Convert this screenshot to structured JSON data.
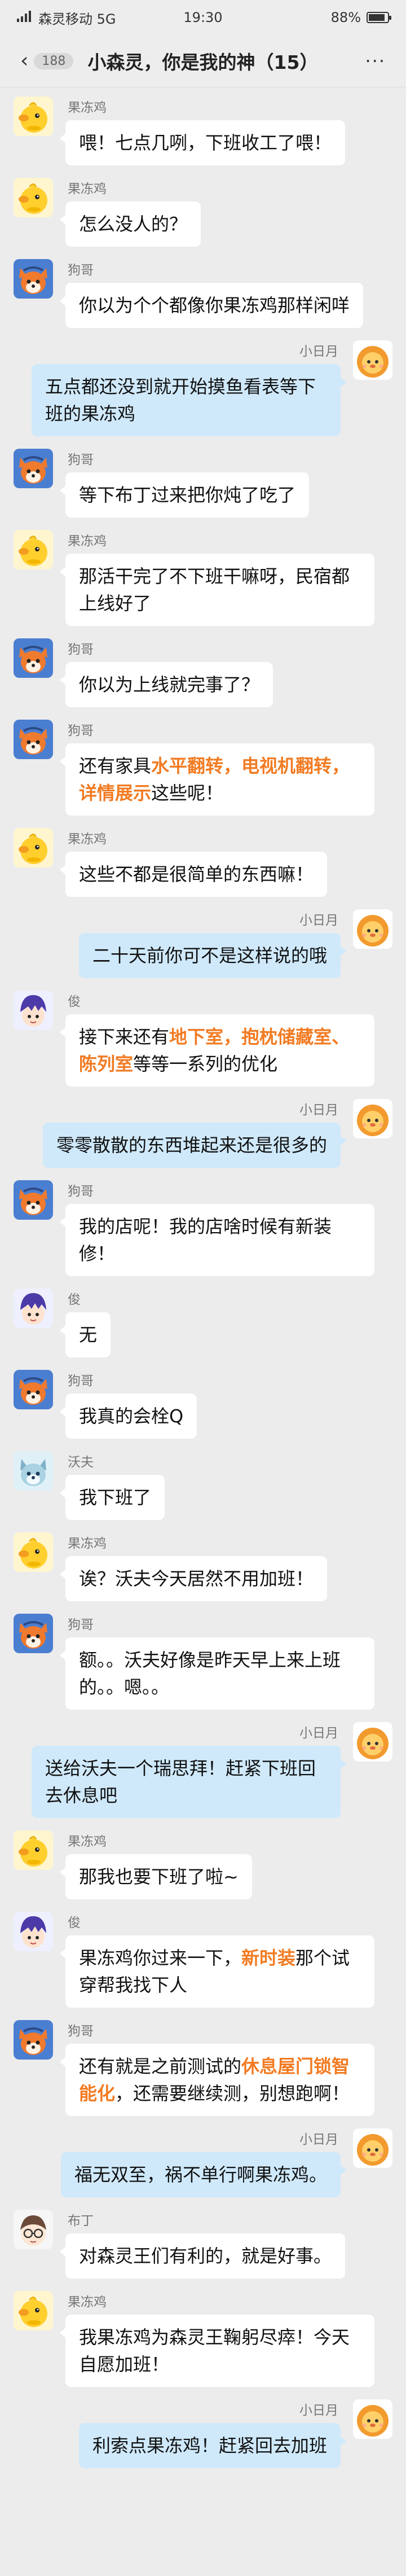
{
  "status_bar": {
    "carrier": "森灵移动 5G",
    "time": "19:30",
    "battery_text": "88%",
    "battery_level": 0.88
  },
  "header": {
    "back_count": "188",
    "title": "小森灵，你是我的神（15）",
    "menu_label": "···"
  },
  "colors": {
    "highlight": "#f27b22",
    "self_bubble": "#cfe9fb",
    "other_bubble": "#ffffff",
    "background": "#ececec"
  },
  "avatars": {
    "果冻鸡": "yellow-chick-avatar",
    "狗哥": "fox-avatar",
    "小日月": "lion-cub-avatar",
    "俊": "purple-hair-avatar",
    "沃夫": "wolf-avatar",
    "布丁": "glasses-avatar"
  },
  "messages": [
    {
      "side": "left",
      "sender": "果冻鸡",
      "segments": [
        {
          "text": "喂！七点几咧，下班收工了喂！"
        }
      ]
    },
    {
      "side": "left",
      "sender": "果冻鸡",
      "segments": [
        {
          "text": "怎么没人的？"
        }
      ]
    },
    {
      "side": "left",
      "sender": "狗哥",
      "segments": [
        {
          "text": "你以为个个都像你果冻鸡那样闲咩"
        }
      ]
    },
    {
      "side": "right",
      "sender": "小日月",
      "segments": [
        {
          "text": "五点都还没到就开始摸鱼看表等下班的果冻鸡"
        }
      ]
    },
    {
      "side": "left",
      "sender": "狗哥",
      "segments": [
        {
          "text": "等下布丁过来把你炖了吃了"
        }
      ]
    },
    {
      "side": "left",
      "sender": "果冻鸡",
      "segments": [
        {
          "text": "那活干完了不下班干嘛呀，民宿都上线好了"
        }
      ]
    },
    {
      "side": "left",
      "sender": "狗哥",
      "segments": [
        {
          "text": "你以为上线就完事了？"
        }
      ]
    },
    {
      "side": "left",
      "sender": "狗哥",
      "segments": [
        {
          "text": "还有家具"
        },
        {
          "text": "水平翻转，电视机翻转，详情展示",
          "hl": true
        },
        {
          "text": "这些呢！"
        }
      ]
    },
    {
      "side": "left",
      "sender": "果冻鸡",
      "segments": [
        {
          "text": "这些不都是很简单的东西嘛！"
        }
      ]
    },
    {
      "side": "right",
      "sender": "小日月",
      "segments": [
        {
          "text": "二十天前你可不是这样说的哦"
        }
      ]
    },
    {
      "side": "left",
      "sender": "俊",
      "segments": [
        {
          "text": "接下来还有"
        },
        {
          "text": "地下室，抱枕储藏室、陈列室",
          "hl": true
        },
        {
          "text": "等等一系列的优化"
        }
      ]
    },
    {
      "side": "right",
      "sender": "小日月",
      "segments": [
        {
          "text": "零零散散的东西堆起来还是很多的"
        }
      ]
    },
    {
      "side": "left",
      "sender": "狗哥",
      "segments": [
        {
          "text": "我的店呢！我的店啥时候有新装修！"
        }
      ]
    },
    {
      "side": "left",
      "sender": "俊",
      "segments": [
        {
          "text": "无"
        }
      ]
    },
    {
      "side": "left",
      "sender": "狗哥",
      "segments": [
        {
          "text": "我真的会栓Q"
        }
      ]
    },
    {
      "side": "left",
      "sender": "沃夫",
      "segments": [
        {
          "text": "我下班了"
        }
      ]
    },
    {
      "side": "left",
      "sender": "果冻鸡",
      "segments": [
        {
          "text": "诶？沃夫今天居然不用加班！"
        }
      ]
    },
    {
      "side": "left",
      "sender": "狗哥",
      "segments": [
        {
          "text": "额。。沃夫好像是昨天早上来上班的。。嗯。。"
        }
      ]
    },
    {
      "side": "right",
      "sender": "小日月",
      "segments": [
        {
          "text": "送给沃夫一个瑞思拜！赶紧下班回去休息吧"
        }
      ]
    },
    {
      "side": "left",
      "sender": "果冻鸡",
      "segments": [
        {
          "text": "那我也要下班了啦~"
        }
      ]
    },
    {
      "side": "left",
      "sender": "俊",
      "segments": [
        {
          "text": "果冻鸡你过来一下，"
        },
        {
          "text": "新时装",
          "hl": true
        },
        {
          "text": "那个试穿帮我找下人"
        }
      ]
    },
    {
      "side": "left",
      "sender": "狗哥",
      "segments": [
        {
          "text": "还有就是之前测试的"
        },
        {
          "text": "休息屋门锁智能化",
          "hl": true
        },
        {
          "text": "，还需要继续测，别想跑啊！"
        }
      ]
    },
    {
      "side": "right",
      "sender": "小日月",
      "segments": [
        {
          "text": "福无双至，祸不单行啊果冻鸡。"
        }
      ]
    },
    {
      "side": "left",
      "sender": "布丁",
      "segments": [
        {
          "text": "对森灵王们有利的，就是好事。"
        }
      ]
    },
    {
      "side": "left",
      "sender": "果冻鸡",
      "segments": [
        {
          "text": "我果冻鸡为森灵王鞠躬尽瘁！今天自愿加班！"
        }
      ]
    },
    {
      "side": "right",
      "sender": "小日月",
      "segments": [
        {
          "text": "利索点果冻鸡！赶紧回去加班"
        }
      ]
    }
  ]
}
